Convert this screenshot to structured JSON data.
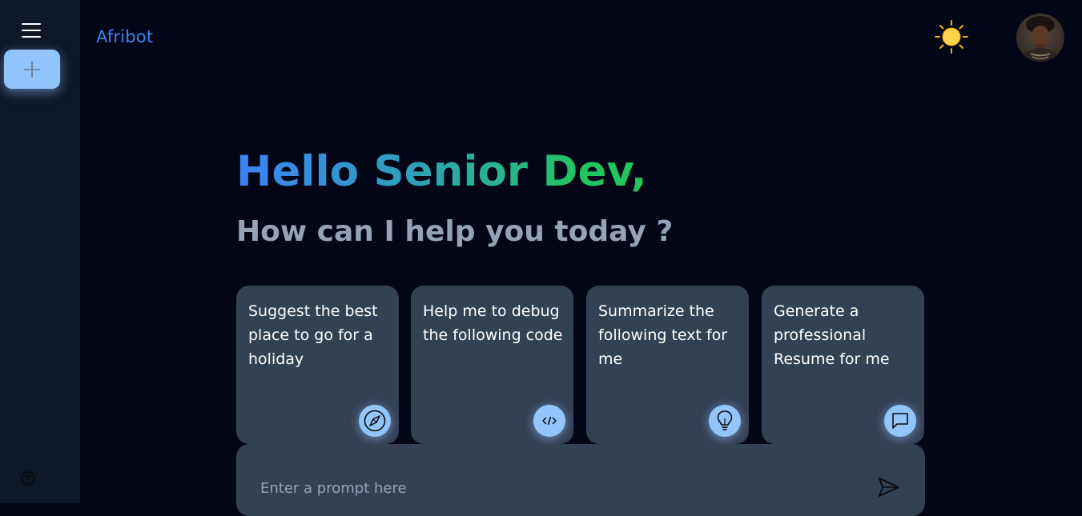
{
  "app": {
    "title": "Afribot"
  },
  "sidebar": {
    "menu_icon": "hamburger-icon",
    "new_chat_icon": "plus-icon",
    "help_icon": "help-circle-icon"
  },
  "header": {
    "theme_icon": "sun-icon",
    "avatar": "user-avatar"
  },
  "greeting": {
    "hello": "Hello Senior Dev,",
    "subtitle": "How can I help you today ?"
  },
  "cards": [
    {
      "text": "Suggest the best place to go for a holiday",
      "icon": "compass-icon"
    },
    {
      "text": "Help me to debug the following code",
      "icon": "code-icon"
    },
    {
      "text": "Summarize the following text for me",
      "icon": "lightbulb-icon"
    },
    {
      "text": "Generate a professional Resume for me",
      "icon": "message-icon"
    }
  ],
  "prompt": {
    "placeholder": "Enter a prompt here",
    "value": "",
    "send_icon": "send-icon"
  },
  "colors": {
    "background": "#030617",
    "sidebar": "#0f172a",
    "card": "#334155",
    "accent": "#93c5fd",
    "brand": "#3b82f6",
    "gradient_start": "#3b82f6",
    "gradient_end": "#22c55e",
    "subtitle": "#94a3b8"
  }
}
